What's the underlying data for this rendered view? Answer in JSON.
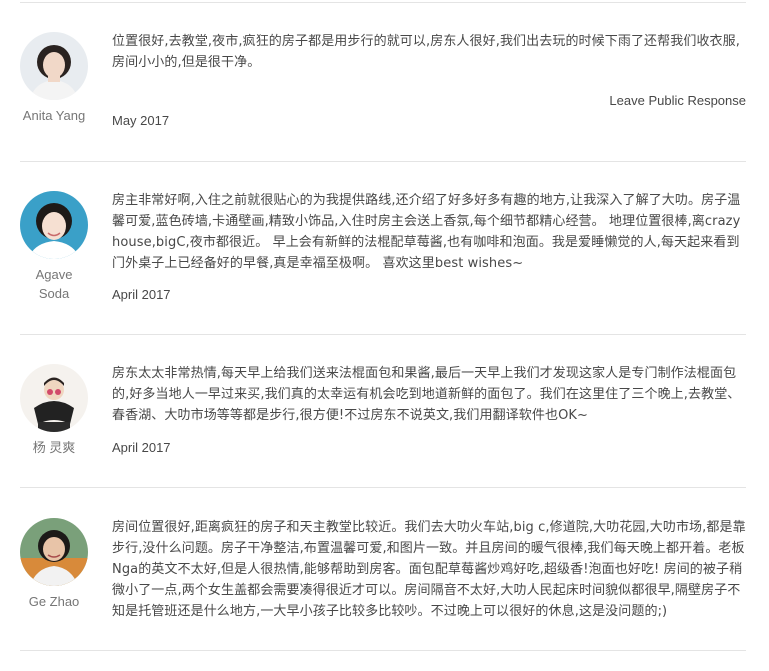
{
  "reviews": [
    {
      "author": "Anita Yang",
      "text": "位置很好,去教堂,夜市,疯狂的房子都是用步行的就可以,房东人很好,我们出去玩的时候下雨了还帮我们收衣服,房间小小的,但是很干净。",
      "date": "May 2017",
      "response_link": "Leave Public Response"
    },
    {
      "author": "Agave Soda",
      "text": "房主非常好啊,入住之前就很贴心的为我提供路线,还介绍了好多好多有趣的地方,让我深入了解了大叻。房子温馨可爱,蓝色砖墙,卡通壁画,精致小饰品,入住时房主会送上香氛,每个细节都精心经营。 地理位置很棒,离crazy house,bigC,夜市都很近。 早上会有新鲜的法棍配草莓酱,也有咖啡和泡面。我是爱睡懒觉的人,每天起来看到门外桌子上已经备好的早餐,真是幸福至极啊。 喜欢这里best wishes~",
      "date": "April 2017"
    },
    {
      "author": "杨 灵爽",
      "text": "房东太太非常热情,每天早上给我们送来法棍面包和果酱,最后一天早上我们才发现这家人是专门制作法棍面包的,好多当地人一早过来买,我们真的太幸运有机会吃到地道新鲜的面包了。我们在这里住了三个晚上,去教堂、春香湖、大叻市场等等都是步行,很方便!不过房东不说英文,我们用翻译软件也OK~",
      "date": "April 2017"
    },
    {
      "author": "Ge Zhao",
      "text": "房间位置很好,距离疯狂的房子和天主教堂比较近。我们去大叻火车站,big c,修道院,大叻花园,大叻市场,都是靠步行,没什么问题。房子干净整洁,布置温馨可爱,和图片一致。并且房间的暖气很棒,我们每天晚上都开着。老板Nga的英文不太好,但是人很热情,能够帮助到房客。面包配草莓酱炒鸡好吃,超级香!泡面也好吃! 房间的被子稍微小了一点,两个女生盖都会需要凑得很近才可以。房间隔音不太好,大叻人民起床时间貌似都很早,隔壁房子不知是托管班还是什么地方,一大早小孩子比较多比较吵。不过晚上可以很好的休息,这是没问题的;)",
      "date": ""
    }
  ],
  "colors": {
    "text": "#484848",
    "muted": "#767676",
    "divider": "#e4e4e4"
  }
}
